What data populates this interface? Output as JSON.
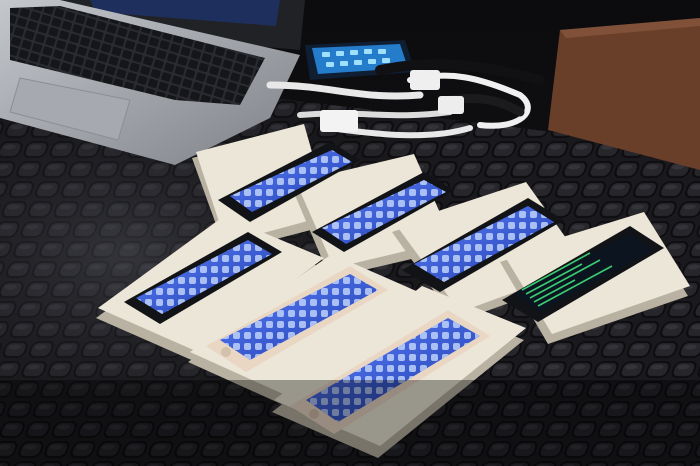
{
  "scene": {
    "subject": "photo",
    "colors": {
      "desk": "#17171a",
      "desk_highlight": "#3a3a40",
      "laptop_body": "#9ea2a8",
      "laptop_keys": "#1c1d21",
      "tray": "#ece6d8",
      "tray_shadow": "#b9b2a2",
      "screen_blue": "#2a4fd6",
      "screen_blue_light": "#5f86ff",
      "screen_dark": "#0c1420",
      "console_green": "#3ee07a",
      "leather": "#6a3f2a",
      "cable": "#e8e8e8",
      "hub_glow": "#33b8ff",
      "phone_black": "#121316",
      "phone_gold": "#e9d7c4"
    },
    "phones": [
      {
        "color": "black",
        "screen": "home"
      },
      {
        "color": "black",
        "screen": "home"
      },
      {
        "color": "black",
        "screen": "home"
      },
      {
        "color": "black",
        "screen": "console"
      },
      {
        "color": "black",
        "screen": "home"
      },
      {
        "color": "gold",
        "screen": "home"
      },
      {
        "color": "gold",
        "screen": "home"
      }
    ]
  }
}
